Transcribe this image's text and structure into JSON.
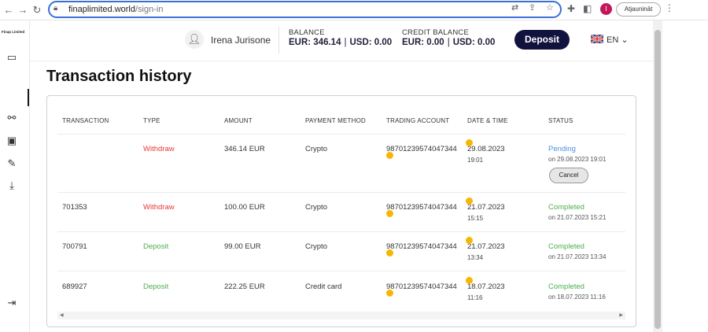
{
  "browser": {
    "url_host": "finaplimited.world",
    "url_path": "/sign-in",
    "update_label": "Atjaunināt",
    "profile_initial": "I"
  },
  "sidebar": {
    "logo": "Finap Limited"
  },
  "header": {
    "user_name": "Irena Jurisone",
    "balance": {
      "title": "BALANCE",
      "eur": "EUR: 346.14",
      "usd": "USD: 0.00"
    },
    "credit_balance": {
      "title": "CREDIT BALANCE",
      "eur": "EUR: 0.00",
      "usd": "USD: 0.00"
    },
    "deposit_label": "Deposit",
    "language": "EN"
  },
  "page": {
    "title": "Transaction history"
  },
  "table": {
    "columns": [
      "TRANSACTION",
      "TYPE",
      "AMOUNT",
      "PAYMENT METHOD",
      "TRADING ACCOUNT",
      "DATE & TIME",
      "STATUS"
    ],
    "rows": [
      {
        "transaction": "",
        "type": "Withdraw",
        "amount": "346.14 EUR",
        "method": "Crypto",
        "account": "98701239574047344",
        "date": "29.08.2023",
        "time": "19:01",
        "status": "Pending",
        "status_detail": "on 29.08.2023 19:01",
        "action": "Cancel"
      },
      {
        "transaction": "701353",
        "type": "Withdraw",
        "amount": "100.00 EUR",
        "method": "Crypto",
        "account": "98701239574047344",
        "date": "21.07.2023",
        "time": "15:15",
        "status": "Completed",
        "status_detail": "on 21.07.2023 15:21"
      },
      {
        "transaction": "700791",
        "type": "Deposit",
        "amount": "99.00 EUR",
        "method": "Crypto",
        "account": "98701239574047344",
        "date": "21.07.2023",
        "time": "13:34",
        "status": "Completed",
        "status_detail": "on 21.07.2023 13:34"
      },
      {
        "transaction": "689927",
        "type": "Deposit",
        "amount": "222.25 EUR",
        "method": "Credit card",
        "account": "98701239574047344",
        "date": "18.07.2023",
        "time": "11:16",
        "status": "Completed",
        "status_detail": "on 18.07.2023 11:16"
      }
    ]
  },
  "colors": {
    "withdraw": "#e53935",
    "deposit": "#4caf50",
    "pending": "#4a90e2",
    "completed": "#4caf50",
    "deposit_button": "#12123f",
    "copy_marker": "#f5b800"
  }
}
